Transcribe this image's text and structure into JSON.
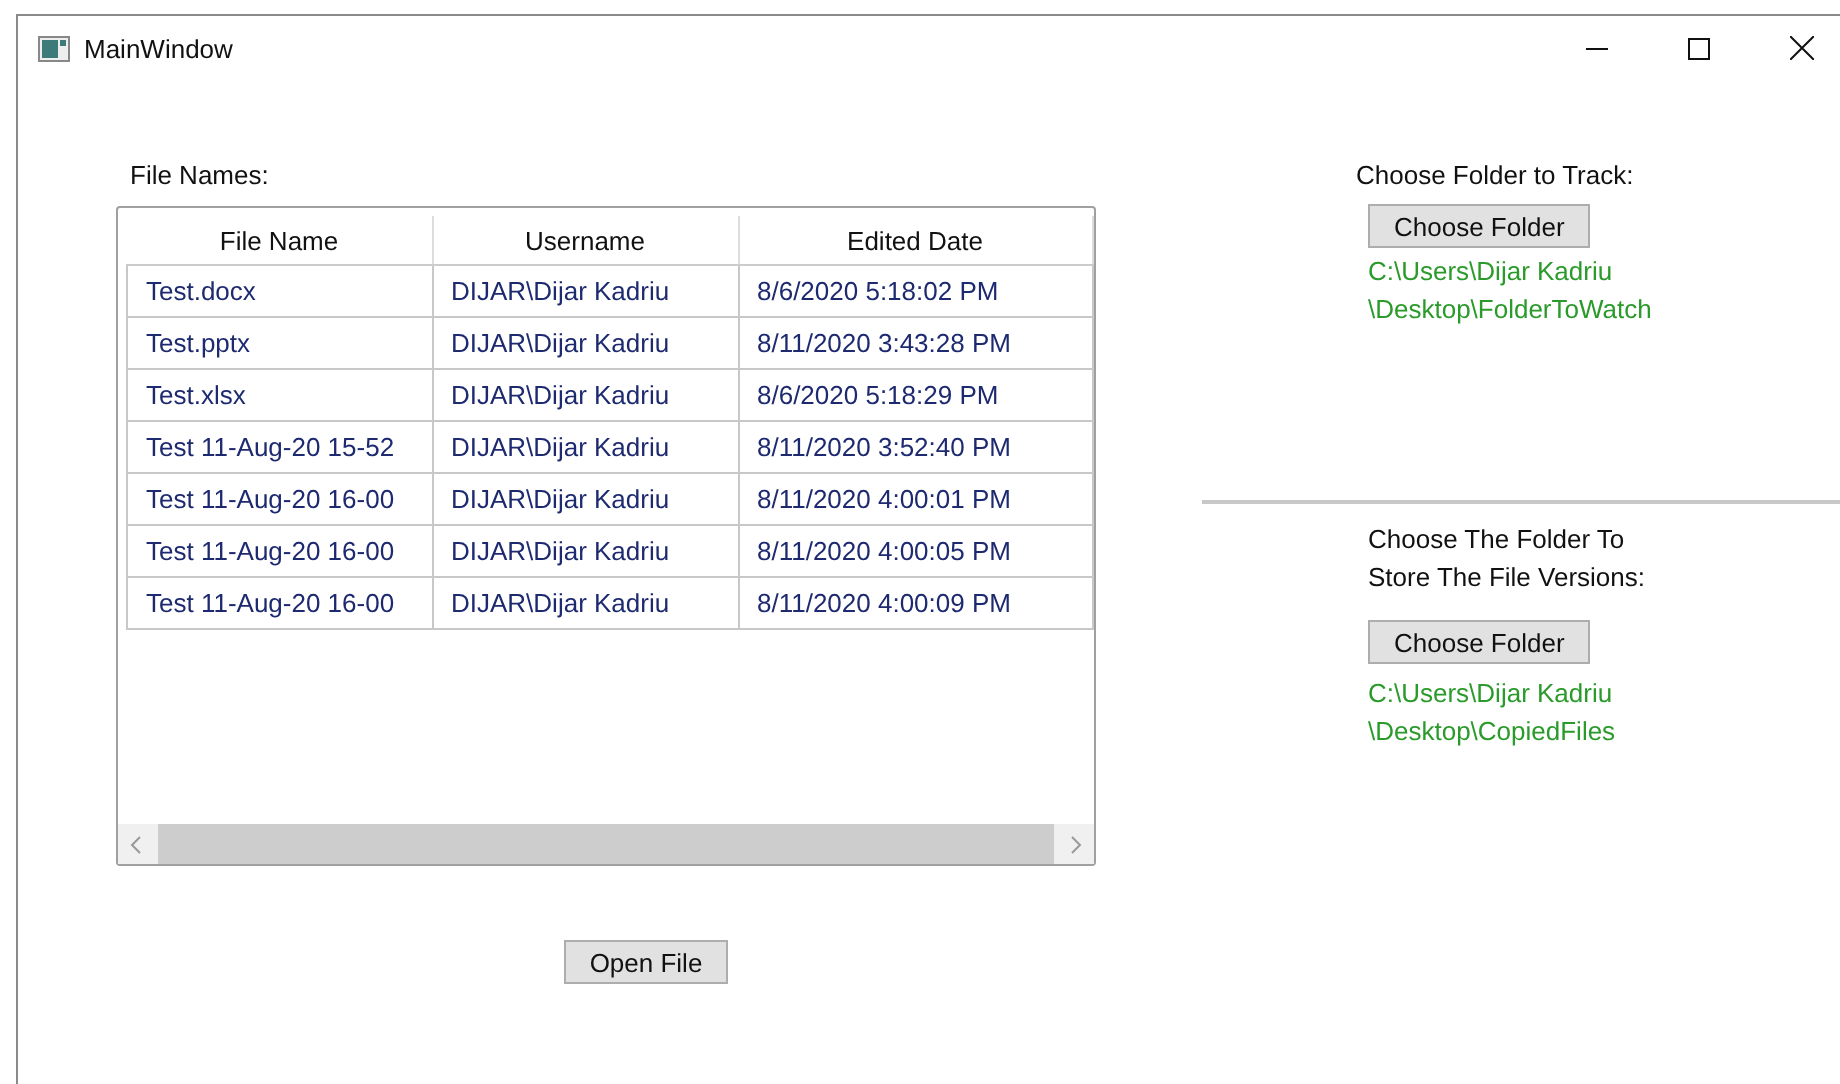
{
  "window": {
    "title": "MainWindow"
  },
  "file_list": {
    "label": "File Names:",
    "columns": [
      "File Name",
      "Username",
      "Edited Date"
    ],
    "rows": [
      [
        "Test.docx",
        "DIJAR\\Dijar Kadriu",
        "8/6/2020 5:18:02 PM"
      ],
      [
        "Test.pptx",
        "DIJAR\\Dijar Kadriu",
        "8/11/2020 3:43:28 PM"
      ],
      [
        "Test.xlsx",
        "DIJAR\\Dijar Kadriu",
        "8/6/2020 5:18:29 PM"
      ],
      [
        "Test 11-Aug-20 15-52",
        "DIJAR\\Dijar Kadriu",
        "8/11/2020 3:52:40 PM"
      ],
      [
        "Test 11-Aug-20 16-00",
        "DIJAR\\Dijar Kadriu",
        "8/11/2020 4:00:01 PM"
      ],
      [
        "Test 11-Aug-20 16-00",
        "DIJAR\\Dijar Kadriu",
        "8/11/2020 4:00:05 PM"
      ],
      [
        "Test 11-Aug-20 16-00",
        "DIJAR\\Dijar Kadriu",
        "8/11/2020 4:00:09 PM"
      ]
    ],
    "open_button": "Open File"
  },
  "folder_sections": [
    {
      "label": [
        "Choose Folder to Track:"
      ],
      "button": "Choose Folder",
      "path": [
        "C:\\Users\\Dijar Kadriu",
        "\\Desktop\\FolderToWatch"
      ]
    },
    {
      "label": [
        "Choose The Folder To",
        "Store The File Versions:"
      ],
      "button": "Choose Folder",
      "path": [
        "C:\\Users\\Dijar Kadriu",
        "\\Desktop\\CopiedFiles"
      ]
    }
  ]
}
